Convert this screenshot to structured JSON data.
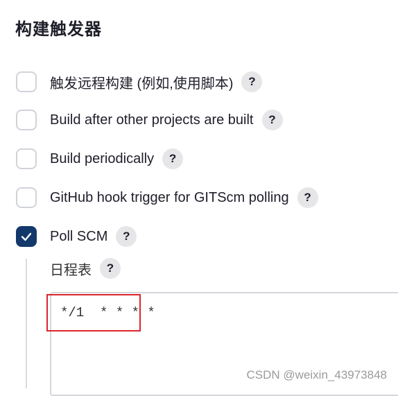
{
  "section": {
    "title": "构建触发器"
  },
  "triggers": [
    {
      "label": "触发远程构建 (例如,使用脚本)",
      "checked": false,
      "help": "?"
    },
    {
      "label": "Build after other projects are built",
      "checked": false,
      "help": "?"
    },
    {
      "label": "Build periodically",
      "checked": false,
      "help": "?"
    },
    {
      "label": "GitHub hook trigger for GITScm polling",
      "checked": false,
      "help": "?"
    },
    {
      "label": "Poll SCM",
      "checked": true,
      "help": "?"
    }
  ],
  "schedule": {
    "label": "日程表",
    "help": "?",
    "value": "*/1  * * * *"
  },
  "watermark": "CSDN @weixin_43973848",
  "colors": {
    "checkbox_checked": "#13396b",
    "highlight": "#d9252b",
    "help_bg": "#e6e6e9"
  }
}
